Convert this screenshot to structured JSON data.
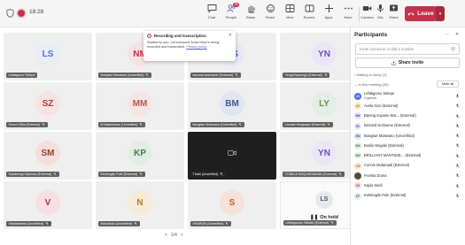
{
  "topbar": {
    "timer": "18:28",
    "buttons": [
      {
        "label": "Chat",
        "icon": "chat-icon",
        "badge": ""
      },
      {
        "label": "People",
        "icon": "people-icon",
        "badge": "35"
      },
      {
        "label": "Raise",
        "icon": "raise-hand-icon",
        "badge": ""
      },
      {
        "label": "React",
        "icon": "react-icon",
        "badge": ""
      },
      {
        "label": "View",
        "icon": "view-icon",
        "badge": ""
      },
      {
        "label": "Rooms",
        "icon": "rooms-icon",
        "badge": ""
      },
      {
        "label": "Apps",
        "icon": "apps-icon",
        "badge": ""
      },
      {
        "label": "More",
        "icon": "more-icon",
        "badge": ""
      },
      {
        "label": "Camera",
        "icon": "camera-icon",
        "badge": ""
      },
      {
        "label": "Mic",
        "icon": "mic-icon",
        "badge": ""
      },
      {
        "label": "Share",
        "icon": "share-icon",
        "badge": ""
      }
    ],
    "leave_label": "Leave"
  },
  "popup": {
    "title": "Recording and transcription",
    "body": "Started by you. Let everyone know they're being recorded and transcribed.",
    "link": "Privacy policy"
  },
  "tiles": [
    {
      "initials": "LS",
      "name": "Lefakgomo Selepe",
      "bg": "#e9edf6",
      "fg": "#4f6bed",
      "style": "avatar"
    },
    {
      "initials": "NM",
      "name": "Nonjabu Mandane (Unverified)",
      "bg": "#f6e3e1",
      "fg": "#c4314b",
      "style": "avatar"
    },
    {
      "initials": "BS",
      "name": "barnard sechoene (External)",
      "bg": "#e7e8f7",
      "fg": "#5b5fc7",
      "style": "avatar"
    },
    {
      "initials": "YN",
      "name": "Yenga Nopengo (External)",
      "bg": "#ebe6f7",
      "fg": "#6b4fbb",
      "style": "avatar"
    },
    {
      "initials": "SZ",
      "name": "Simon Zitha (External)",
      "bg": "#f6e3e1",
      "fg": "#b4373c",
      "style": "avatar"
    },
    {
      "initials": "MM",
      "name": "M Mashiloane (Unverified)",
      "bg": "#f6e6e3",
      "fg": "#b35a43",
      "style": "avatar"
    },
    {
      "initials": "BM",
      "name": "Bongiwe Mobwano (Unverified)",
      "bg": "#dfe6f2",
      "fg": "#3f5c8a",
      "style": "avatar"
    },
    {
      "initials": "LY",
      "name": "Lamatd Yengwayo (External)",
      "bg": "#e3eee4",
      "fg": "#6b8f5a",
      "style": "avatar"
    },
    {
      "initials": "SM",
      "name": "Sipekerego Mphosa (External)",
      "bg": "#f3dfdc",
      "fg": "#9b3c32",
      "style": "avatar"
    },
    {
      "initials": "KP",
      "name": "Kelebogile Pule (External)",
      "bg": "#e2eee4",
      "fg": "#3f7a4f",
      "style": "avatar"
    },
    {
      "initials": "",
      "name": "Thato (Unverified)",
      "bg": "#1f1f1f",
      "fg": "#ffffff",
      "style": "dark"
    },
    {
      "initials": "YN",
      "name": "YONELA NGQUNGWANA (External)",
      "bg": "#ebe6f7",
      "fg": "#6b4fbb",
      "style": "avatar"
    },
    {
      "initials": "V",
      "name": "Vhahwamba (Unverified)",
      "bg": "#f6e0e4",
      "fg": "#b4304f",
      "style": "avatar"
    },
    {
      "initials": "N",
      "name": "Nokuthula (Unverified)",
      "bg": "#f6ebd9",
      "fg": "#b07a2a",
      "style": "avatar"
    },
    {
      "initials": "S",
      "name": "SHARON (Unverified)",
      "bg": "#f6e2d8",
      "fg": "#c05a2b",
      "style": "avatar"
    },
    {
      "initials": "LS",
      "name": "Lehlogonolo Sebato (External)",
      "bg": "#e6e8ee",
      "fg": "#4a5466",
      "style": "onhold",
      "hold_label": "On hold"
    }
  ],
  "pager": {
    "prev": "<",
    "label": "1/4",
    "next": ">"
  },
  "panel": {
    "title": "Participants",
    "search_placeholder": "Invite someone or dial a number",
    "share_invite": "Share invite",
    "waiting_label": "Waiting in lobby (1)",
    "in_meeting_label": "In this meeting (35)",
    "mute_all": "Mute all",
    "participants": [
      {
        "initials": "LS",
        "name": "Lefakgomo Selepe",
        "sub": "Organiser",
        "bg": "#4f6bed",
        "fg": "#ffffff",
        "mic": "on"
      },
      {
        "initials": "AS",
        "name": "Avela Sizo (External)",
        "sub": "",
        "bg": "#fde7c7",
        "fg": "#b07a2a",
        "mic": "off"
      },
      {
        "initials": "BM",
        "name": "Bareng Kopano Mot... (External)",
        "sub": "",
        "bg": "#dfe6f2",
        "fg": "#3f5c8a",
        "mic": "off"
      },
      {
        "initials": "BS",
        "name": "barnard sechoene (External)",
        "sub": "",
        "bg": "#e7e8f7",
        "fg": "#5b5fc7",
        "mic": "off"
      },
      {
        "initials": "BM",
        "name": "Bongiwe Mobwano (Unverified)",
        "sub": "",
        "bg": "#dfe6f2",
        "fg": "#3f5c8a",
        "mic": "off"
      },
      {
        "initials": "BM",
        "name": "Bonile Mogale (External)",
        "sub": "",
        "bg": "#e2eee4",
        "fg": "#3f7a4f",
        "mic": "off"
      },
      {
        "initials": "BM",
        "name": "BRILLIANT MANTSHE... (External)",
        "sub": "",
        "bg": "#e2eee4",
        "fg": "#3f7a4f",
        "mic": "off"
      },
      {
        "initials": "CM",
        "name": "Connie Mufamadi (External)",
        "sub": "",
        "bg": "#fde7c7",
        "fg": "#b07a2a",
        "mic": "off"
      },
      {
        "initials": "",
        "name": "Fezeka Duma",
        "sub": "",
        "bg": "#5a4a3a",
        "fg": "#ffffff",
        "mic": "off"
      },
      {
        "initials": "KS",
        "name": "Kayla Seidi",
        "sub": "",
        "bg": "#f6e0e4",
        "fg": "#b4304f",
        "mic": "off"
      },
      {
        "initials": "KP",
        "name": "Kelebogile Pule (External)",
        "sub": "",
        "bg": "#e2eee4",
        "fg": "#3f7a4f",
        "mic": "off"
      }
    ]
  }
}
